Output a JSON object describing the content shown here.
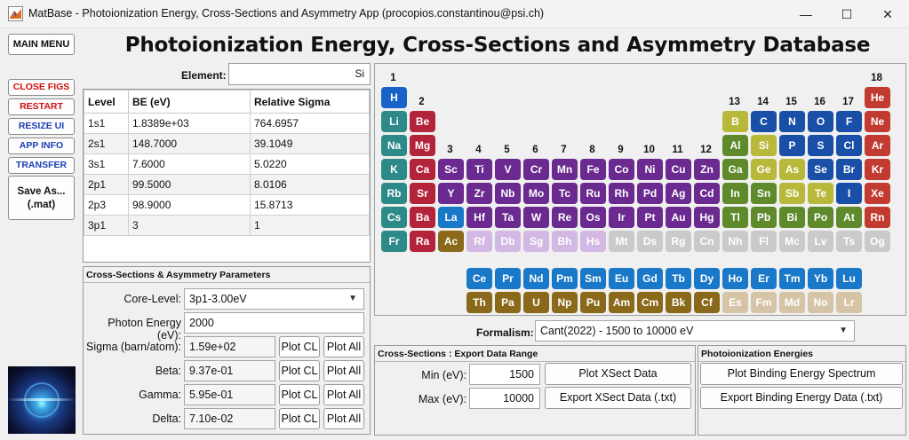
{
  "window": {
    "title": "MatBase - Photoionization Energy, Cross-Sections and Asymmetry App (procopios.constantinou@psi.ch)",
    "min_glyph": "—",
    "max_glyph": "☐",
    "close_glyph": "✕"
  },
  "heading": "Photoionization Energy, Cross-Sections and Asymmetry Database",
  "sidebar": {
    "main_menu": "MAIN MENU",
    "close_figs": "CLOSE FIGS",
    "restart": "RESTART",
    "resize_ui": "RESIZE UI",
    "app_info": "APP INFO",
    "transfer": "TRANSFER",
    "save_as_line1": "Save As...",
    "save_as_line2": "(.mat)"
  },
  "element": {
    "label": "Element:",
    "value": "Si"
  },
  "level_table": {
    "headers": [
      "Level",
      "BE (eV)",
      "Relative Sigma"
    ],
    "rows": [
      [
        "1s1",
        "1.8389e+03",
        "764.6957"
      ],
      [
        "2s1",
        "148.7000",
        "39.1049"
      ],
      [
        "3s1",
        "7.6000",
        "5.0220"
      ],
      [
        "2p1",
        "99.5000",
        "8.0106"
      ],
      [
        "2p3",
        "98.9000",
        "15.8713"
      ],
      [
        "3p1",
        "3",
        "1"
      ]
    ]
  },
  "cs_panel": {
    "title": "Cross-Sections & Asymmetry Parameters",
    "core_level_label": "Core-Level:",
    "core_level_value": "3p1-3.00eV",
    "photon_energy_label": "Photon Energy (eV):",
    "photon_energy_value": "2000",
    "sigma_label": "Sigma (barn/atom):",
    "sigma_value": "1.59e+02",
    "beta_label": "Beta:",
    "beta_value": "9.37e-01",
    "gamma_label": "Gamma:",
    "gamma_value": "5.95e-01",
    "delta_label": "Delta:",
    "delta_value": "7.10e-02",
    "plot_cl": "Plot CL",
    "plot_all": "Plot All"
  },
  "formalism": {
    "label": "Formalism:",
    "value": "Cant(2022) - 1500 to 10000 eV"
  },
  "export_panel": {
    "title": "Cross-Sections : Export Data Range",
    "min_label": "Min (eV):",
    "min_value": "1500",
    "max_label": "Max (eV):",
    "max_value": "10000",
    "plot_xsect": "Plot XSect Data",
    "export_xsect": "Export XSect Data (.txt)"
  },
  "energies_panel": {
    "title": "Photoionization Energies",
    "plot_be": "Plot Binding Energy Spectrum",
    "export_be": "Export Binding Energy Data (.txt)"
  },
  "periodic_table": {
    "colors": {
      "alkali": "#2e8a88",
      "alkaline": "#b3243a",
      "transition": "#6a2a90",
      "post_transition": "#5e8a2c",
      "metalloid": "#b8b83a",
      "nonmetal": "#1a4fa8",
      "noble": "#c23a30",
      "group3": "#8a6a1a",
      "actinide_lower": "#8a6a1a",
      "h": "#1763c8",
      "lanthanide": "#1a78c8",
      "actinide": "#8a6a1a",
      "synth_purple": "#d2b8e2",
      "synth_gray": "#cacaca",
      "synth_green": "#c2cfb0",
      "synth_yellow": "#d6d69a",
      "synth_blue": "#a8c0e2",
      "synth_tan": "#d6c4a6"
    },
    "group_numbers": [
      "1",
      "2",
      "3",
      "4",
      "5",
      "6",
      "7",
      "8",
      "9",
      "10",
      "11",
      "12",
      "13",
      "14",
      "15",
      "16",
      "17",
      "18"
    ],
    "elements": [
      {
        "s": "H",
        "c": "h"
      },
      {
        "s": "He",
        "c": "noble"
      },
      {
        "s": "Li",
        "c": "alkali"
      },
      {
        "s": "Be",
        "c": "alkaline"
      },
      {
        "s": "B",
        "c": "metalloid"
      },
      {
        "s": "C",
        "c": "nonmetal"
      },
      {
        "s": "N",
        "c": "nonmetal"
      },
      {
        "s": "O",
        "c": "nonmetal"
      },
      {
        "s": "F",
        "c": "nonmetal"
      },
      {
        "s": "Ne",
        "c": "noble"
      },
      {
        "s": "Na",
        "c": "alkali"
      },
      {
        "s": "Mg",
        "c": "alkaline"
      },
      {
        "s": "Al",
        "c": "post_transition"
      },
      {
        "s": "Si",
        "c": "metalloid"
      },
      {
        "s": "P",
        "c": "nonmetal"
      },
      {
        "s": "S",
        "c": "nonmetal"
      },
      {
        "s": "Cl",
        "c": "nonmetal"
      },
      {
        "s": "Ar",
        "c": "noble"
      },
      {
        "s": "K",
        "c": "alkali"
      },
      {
        "s": "Ca",
        "c": "alkaline"
      },
      {
        "s": "Sc",
        "c": "transition"
      },
      {
        "s": "Ti",
        "c": "transition"
      },
      {
        "s": "V",
        "c": "transition"
      },
      {
        "s": "Cr",
        "c": "transition"
      },
      {
        "s": "Mn",
        "c": "transition"
      },
      {
        "s": "Fe",
        "c": "transition"
      },
      {
        "s": "Co",
        "c": "transition"
      },
      {
        "s": "Ni",
        "c": "transition"
      },
      {
        "s": "Cu",
        "c": "transition"
      },
      {
        "s": "Zn",
        "c": "transition"
      },
      {
        "s": "Ga",
        "c": "post_transition"
      },
      {
        "s": "Ge",
        "c": "metalloid"
      },
      {
        "s": "As",
        "c": "metalloid"
      },
      {
        "s": "Se",
        "c": "nonmetal"
      },
      {
        "s": "Br",
        "c": "nonmetal"
      },
      {
        "s": "Kr",
        "c": "noble"
      },
      {
        "s": "Rb",
        "c": "alkali"
      },
      {
        "s": "Sr",
        "c": "alkaline"
      },
      {
        "s": "Y",
        "c": "transition"
      },
      {
        "s": "Zr",
        "c": "transition"
      },
      {
        "s": "Nb",
        "c": "transition"
      },
      {
        "s": "Mo",
        "c": "transition"
      },
      {
        "s": "Tc",
        "c": "transition"
      },
      {
        "s": "Ru",
        "c": "transition"
      },
      {
        "s": "Rh",
        "c": "transition"
      },
      {
        "s": "Pd",
        "c": "transition"
      },
      {
        "s": "Ag",
        "c": "transition"
      },
      {
        "s": "Cd",
        "c": "transition"
      },
      {
        "s": "In",
        "c": "post_transition"
      },
      {
        "s": "Sn",
        "c": "post_transition"
      },
      {
        "s": "Sb",
        "c": "metalloid"
      },
      {
        "s": "Te",
        "c": "metalloid"
      },
      {
        "s": "I",
        "c": "nonmetal"
      },
      {
        "s": "Xe",
        "c": "noble"
      },
      {
        "s": "Cs",
        "c": "alkali"
      },
      {
        "s": "Ba",
        "c": "alkaline"
      },
      {
        "s": "La",
        "c": "lanthanide"
      },
      {
        "s": "Hf",
        "c": "transition"
      },
      {
        "s": "Ta",
        "c": "transition"
      },
      {
        "s": "W",
        "c": "transition"
      },
      {
        "s": "Re",
        "c": "transition"
      },
      {
        "s": "Os",
        "c": "transition"
      },
      {
        "s": "Ir",
        "c": "transition"
      },
      {
        "s": "Pt",
        "c": "transition"
      },
      {
        "s": "Au",
        "c": "transition"
      },
      {
        "s": "Hg",
        "c": "transition"
      },
      {
        "s": "Tl",
        "c": "post_transition"
      },
      {
        "s": "Pb",
        "c": "post_transition"
      },
      {
        "s": "Bi",
        "c": "post_transition"
      },
      {
        "s": "Po",
        "c": "post_transition"
      },
      {
        "s": "At",
        "c": "post_transition"
      },
      {
        "s": "Rn",
        "c": "noble"
      },
      {
        "s": "Fr",
        "c": "alkali"
      },
      {
        "s": "Ra",
        "c": "alkaline"
      },
      {
        "s": "Ac",
        "c": "actinide"
      },
      {
        "s": "Rf",
        "c": "synth_purple"
      },
      {
        "s": "Db",
        "c": "synth_purple"
      },
      {
        "s": "Sg",
        "c": "synth_purple"
      },
      {
        "s": "Bh",
        "c": "synth_purple"
      },
      {
        "s": "Hs",
        "c": "synth_purple"
      },
      {
        "s": "Mt",
        "c": "synth_gray"
      },
      {
        "s": "Ds",
        "c": "synth_gray"
      },
      {
        "s": "Rg",
        "c": "synth_gray"
      },
      {
        "s": "Cn",
        "c": "synth_gray"
      },
      {
        "s": "Nh",
        "c": "synth_gray"
      },
      {
        "s": "Fl",
        "c": "synth_gray"
      },
      {
        "s": "Mc",
        "c": "synth_gray"
      },
      {
        "s": "Lv",
        "c": "synth_gray"
      },
      {
        "s": "Ts",
        "c": "synth_gray"
      },
      {
        "s": "Og",
        "c": "synth_gray"
      },
      {
        "s": "Ce",
        "c": "lanthanide"
      },
      {
        "s": "Pr",
        "c": "lanthanide"
      },
      {
        "s": "Nd",
        "c": "lanthanide"
      },
      {
        "s": "Pm",
        "c": "lanthanide"
      },
      {
        "s": "Sm",
        "c": "lanthanide"
      },
      {
        "s": "Eu",
        "c": "lanthanide"
      },
      {
        "s": "Gd",
        "c": "lanthanide"
      },
      {
        "s": "Tb",
        "c": "lanthanide"
      },
      {
        "s": "Dy",
        "c": "lanthanide"
      },
      {
        "s": "Ho",
        "c": "lanthanide"
      },
      {
        "s": "Er",
        "c": "lanthanide"
      },
      {
        "s": "Tm",
        "c": "lanthanide"
      },
      {
        "s": "Yb",
        "c": "lanthanide"
      },
      {
        "s": "Lu",
        "c": "lanthanide"
      },
      {
        "s": "Th",
        "c": "actinide"
      },
      {
        "s": "Pa",
        "c": "actinide"
      },
      {
        "s": "U",
        "c": "actinide"
      },
      {
        "s": "Np",
        "c": "actinide"
      },
      {
        "s": "Pu",
        "c": "actinide"
      },
      {
        "s": "Am",
        "c": "actinide"
      },
      {
        "s": "Cm",
        "c": "actinide"
      },
      {
        "s": "Bk",
        "c": "actinide"
      },
      {
        "s": "Cf",
        "c": "actinide"
      },
      {
        "s": "Es",
        "c": "synth_tan"
      },
      {
        "s": "Fm",
        "c": "synth_tan"
      },
      {
        "s": "Md",
        "c": "synth_tan"
      },
      {
        "s": "No",
        "c": "synth_tan"
      },
      {
        "s": "Lr",
        "c": "synth_tan"
      }
    ]
  }
}
